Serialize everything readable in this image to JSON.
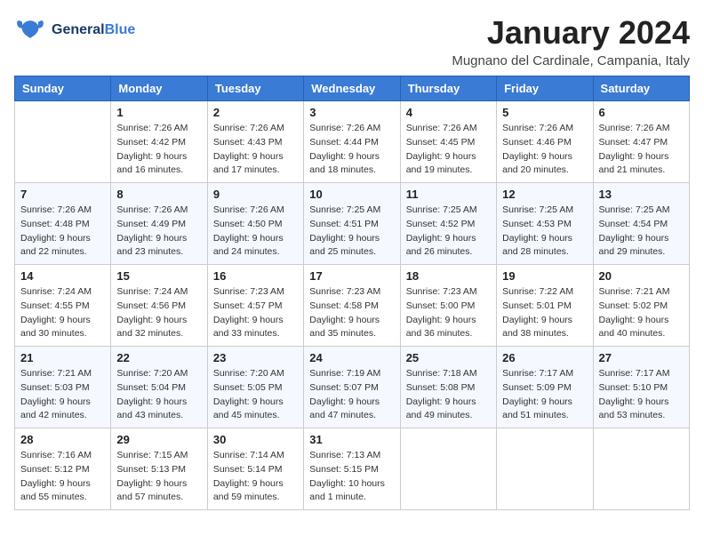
{
  "logo": {
    "line1": "General",
    "line2": "Blue"
  },
  "title": "January 2024",
  "location": "Mugnano del Cardinale, Campania, Italy",
  "days_of_week": [
    "Sunday",
    "Monday",
    "Tuesday",
    "Wednesday",
    "Thursday",
    "Friday",
    "Saturday"
  ],
  "weeks": [
    [
      {
        "day": "",
        "info": ""
      },
      {
        "day": "1",
        "info": "Sunrise: 7:26 AM\nSunset: 4:42 PM\nDaylight: 9 hours\nand 16 minutes."
      },
      {
        "day": "2",
        "info": "Sunrise: 7:26 AM\nSunset: 4:43 PM\nDaylight: 9 hours\nand 17 minutes."
      },
      {
        "day": "3",
        "info": "Sunrise: 7:26 AM\nSunset: 4:44 PM\nDaylight: 9 hours\nand 18 minutes."
      },
      {
        "day": "4",
        "info": "Sunrise: 7:26 AM\nSunset: 4:45 PM\nDaylight: 9 hours\nand 19 minutes."
      },
      {
        "day": "5",
        "info": "Sunrise: 7:26 AM\nSunset: 4:46 PM\nDaylight: 9 hours\nand 20 minutes."
      },
      {
        "day": "6",
        "info": "Sunrise: 7:26 AM\nSunset: 4:47 PM\nDaylight: 9 hours\nand 21 minutes."
      }
    ],
    [
      {
        "day": "7",
        "info": "Sunrise: 7:26 AM\nSunset: 4:48 PM\nDaylight: 9 hours\nand 22 minutes."
      },
      {
        "day": "8",
        "info": "Sunrise: 7:26 AM\nSunset: 4:49 PM\nDaylight: 9 hours\nand 23 minutes."
      },
      {
        "day": "9",
        "info": "Sunrise: 7:26 AM\nSunset: 4:50 PM\nDaylight: 9 hours\nand 24 minutes."
      },
      {
        "day": "10",
        "info": "Sunrise: 7:25 AM\nSunset: 4:51 PM\nDaylight: 9 hours\nand 25 minutes."
      },
      {
        "day": "11",
        "info": "Sunrise: 7:25 AM\nSunset: 4:52 PM\nDaylight: 9 hours\nand 26 minutes."
      },
      {
        "day": "12",
        "info": "Sunrise: 7:25 AM\nSunset: 4:53 PM\nDaylight: 9 hours\nand 28 minutes."
      },
      {
        "day": "13",
        "info": "Sunrise: 7:25 AM\nSunset: 4:54 PM\nDaylight: 9 hours\nand 29 minutes."
      }
    ],
    [
      {
        "day": "14",
        "info": "Sunrise: 7:24 AM\nSunset: 4:55 PM\nDaylight: 9 hours\nand 30 minutes."
      },
      {
        "day": "15",
        "info": "Sunrise: 7:24 AM\nSunset: 4:56 PM\nDaylight: 9 hours\nand 32 minutes."
      },
      {
        "day": "16",
        "info": "Sunrise: 7:23 AM\nSunset: 4:57 PM\nDaylight: 9 hours\nand 33 minutes."
      },
      {
        "day": "17",
        "info": "Sunrise: 7:23 AM\nSunset: 4:58 PM\nDaylight: 9 hours\nand 35 minutes."
      },
      {
        "day": "18",
        "info": "Sunrise: 7:23 AM\nSunset: 5:00 PM\nDaylight: 9 hours\nand 36 minutes."
      },
      {
        "day": "19",
        "info": "Sunrise: 7:22 AM\nSunset: 5:01 PM\nDaylight: 9 hours\nand 38 minutes."
      },
      {
        "day": "20",
        "info": "Sunrise: 7:21 AM\nSunset: 5:02 PM\nDaylight: 9 hours\nand 40 minutes."
      }
    ],
    [
      {
        "day": "21",
        "info": "Sunrise: 7:21 AM\nSunset: 5:03 PM\nDaylight: 9 hours\nand 42 minutes."
      },
      {
        "day": "22",
        "info": "Sunrise: 7:20 AM\nSunset: 5:04 PM\nDaylight: 9 hours\nand 43 minutes."
      },
      {
        "day": "23",
        "info": "Sunrise: 7:20 AM\nSunset: 5:05 PM\nDaylight: 9 hours\nand 45 minutes."
      },
      {
        "day": "24",
        "info": "Sunrise: 7:19 AM\nSunset: 5:07 PM\nDaylight: 9 hours\nand 47 minutes."
      },
      {
        "day": "25",
        "info": "Sunrise: 7:18 AM\nSunset: 5:08 PM\nDaylight: 9 hours\nand 49 minutes."
      },
      {
        "day": "26",
        "info": "Sunrise: 7:17 AM\nSunset: 5:09 PM\nDaylight: 9 hours\nand 51 minutes."
      },
      {
        "day": "27",
        "info": "Sunrise: 7:17 AM\nSunset: 5:10 PM\nDaylight: 9 hours\nand 53 minutes."
      }
    ],
    [
      {
        "day": "28",
        "info": "Sunrise: 7:16 AM\nSunset: 5:12 PM\nDaylight: 9 hours\nand 55 minutes."
      },
      {
        "day": "29",
        "info": "Sunrise: 7:15 AM\nSunset: 5:13 PM\nDaylight: 9 hours\nand 57 minutes."
      },
      {
        "day": "30",
        "info": "Sunrise: 7:14 AM\nSunset: 5:14 PM\nDaylight: 9 hours\nand 59 minutes."
      },
      {
        "day": "31",
        "info": "Sunrise: 7:13 AM\nSunset: 5:15 PM\nDaylight: 10 hours\nand 1 minute."
      },
      {
        "day": "",
        "info": ""
      },
      {
        "day": "",
        "info": ""
      },
      {
        "day": "",
        "info": ""
      }
    ]
  ]
}
